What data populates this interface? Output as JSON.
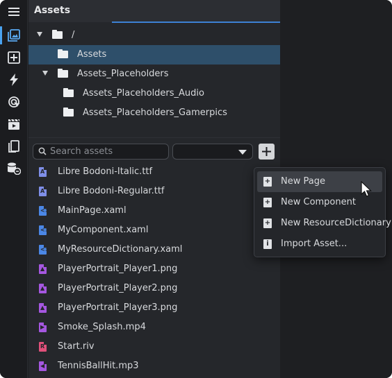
{
  "panel": {
    "title": "Assets"
  },
  "tree": [
    {
      "label": "/",
      "expanded": true,
      "selected": false
    },
    {
      "label": "Assets",
      "expanded": false,
      "selected": true
    },
    {
      "label": "Assets_Placeholders",
      "expanded": true,
      "selected": false
    },
    {
      "label": "Assets_Placeholders_Audio",
      "expanded": false,
      "selected": false
    },
    {
      "label": "Assets_Placeholders_Gamerpics",
      "expanded": false,
      "selected": false
    }
  ],
  "search": {
    "placeholder": "Search assets",
    "value": ""
  },
  "filter": {
    "value": ""
  },
  "add_button": {
    "label": "+"
  },
  "files": [
    {
      "name": "Libre Bodoni-Italic.ttf",
      "icon": "font-file-icon",
      "color": "#7f8fe8",
      "glyph": "A"
    },
    {
      "name": "Libre Bodoni-Regular.ttf",
      "icon": "font-file-icon",
      "color": "#7f8fe8",
      "glyph": "A"
    },
    {
      "name": "MainPage.xaml",
      "icon": "xaml-file-icon",
      "color": "#4b87e6",
      "glyph": "<>"
    },
    {
      "name": "MyComponent.xaml",
      "icon": "xaml-file-icon",
      "color": "#4b87e6",
      "glyph": "<>"
    },
    {
      "name": "MyResourceDictionary.xaml",
      "icon": "xaml-file-icon",
      "color": "#4b87e6",
      "glyph": "<>"
    },
    {
      "name": "PlayerPortrait_Player1.png",
      "icon": "image-file-icon",
      "color": "#a557e0",
      "glyph": "▲"
    },
    {
      "name": "PlayerPortrait_Player2.png",
      "icon": "image-file-icon",
      "color": "#a557e0",
      "glyph": "▲"
    },
    {
      "name": "PlayerPortrait_Player3.png",
      "icon": "image-file-icon",
      "color": "#a557e0",
      "glyph": "▲"
    },
    {
      "name": "Smoke_Splash.mp4",
      "icon": "video-file-icon",
      "color": "#a557e0",
      "glyph": "▶"
    },
    {
      "name": "Start.riv",
      "icon": "rive-file-icon",
      "color": "#e0507a",
      "glyph": "R"
    },
    {
      "name": "TennisBallHit.mp3",
      "icon": "audio-file-icon",
      "color": "#a557e0",
      "glyph": "◀"
    }
  ],
  "menu": [
    {
      "label": "New Page",
      "icon": "new-page-icon",
      "glyph": "+"
    },
    {
      "label": "New Component",
      "icon": "new-component-icon",
      "glyph": "+"
    },
    {
      "label": "New ResourceDictionary",
      "icon": "new-resource-dictionary-icon",
      "glyph": "+"
    },
    {
      "label": "Import Asset...",
      "icon": "import-asset-icon",
      "glyph": "i"
    }
  ],
  "activity_bar": [
    {
      "icon": "hamburger-menu-icon"
    },
    {
      "icon": "assets-icon",
      "active": true
    },
    {
      "icon": "add-box-icon"
    },
    {
      "icon": "lightning-icon"
    },
    {
      "icon": "target-icon"
    },
    {
      "icon": "clapperboard-icon"
    },
    {
      "icon": "pages-icon"
    },
    {
      "icon": "database-link-icon"
    }
  ],
  "colors": {
    "accent": "#3d82d6",
    "selection": "#2e4f6a",
    "hover": "#3d4046"
  }
}
